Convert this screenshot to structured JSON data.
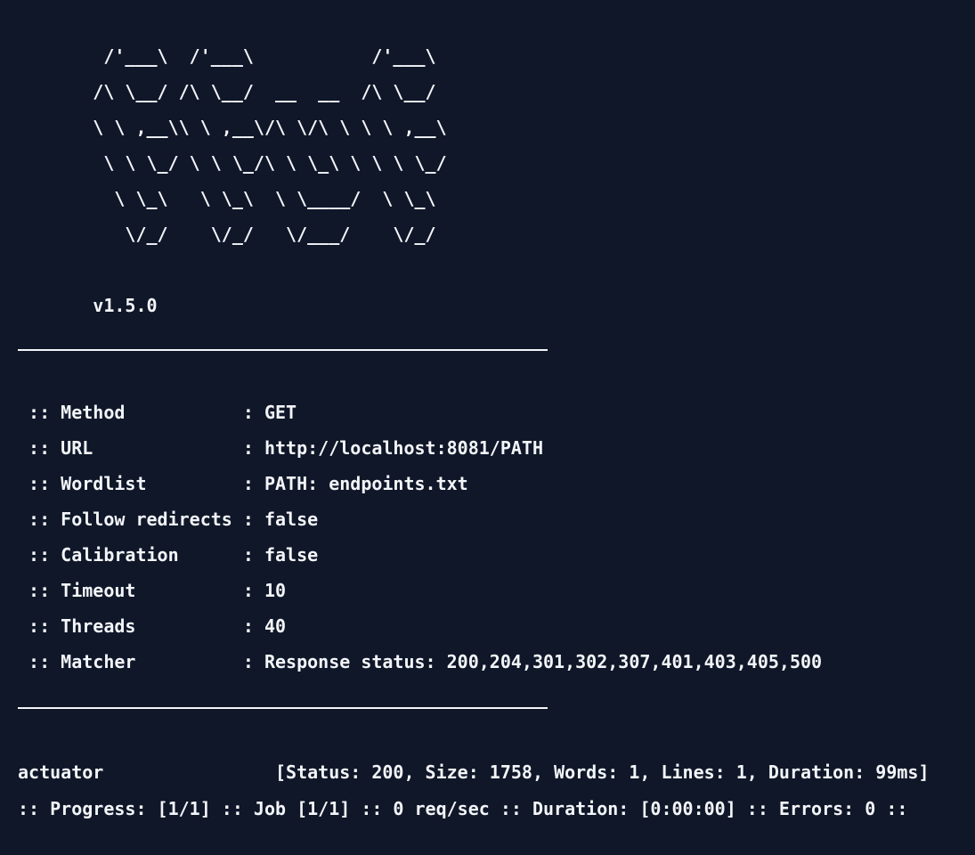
{
  "banner": {
    "art": [
      "        /'___\\  /'___\\           /'___\\",
      "       /\\ \\__/ /\\ \\__/  __  __  /\\ \\__/",
      "       \\ \\ ,__\\\\ \\ ,__\\/\\ \\/\\ \\ \\ \\ ,__\\",
      "        \\ \\ \\_/ \\ \\ \\_/\\ \\ \\_\\ \\ \\ \\ \\_/",
      "         \\ \\_\\   \\ \\_\\  \\ \\____/  \\ \\_\\",
      "          \\/_/    \\/_/   \\/___/    \\/_/"
    ],
    "version": "       v1.5.0"
  },
  "config": [
    " :: Method           : GET",
    " :: URL              : http://localhost:8081/PATH",
    " :: Wordlist         : PATH: endpoints.txt",
    " :: Follow redirects : false",
    " :: Calibration      : false",
    " :: Timeout          : 10",
    " :: Threads          : 40",
    " :: Matcher          : Response status: 200,204,301,302,307,401,403,405,500"
  ],
  "results": [
    "actuator                [Status: 200, Size: 1758, Words: 1, Lines: 1, Duration: 99ms]"
  ],
  "progress": ":: Progress: [1/1] :: Job [1/1] :: 0 req/sec :: Duration: [0:00:00] :: Errors: 0 ::"
}
